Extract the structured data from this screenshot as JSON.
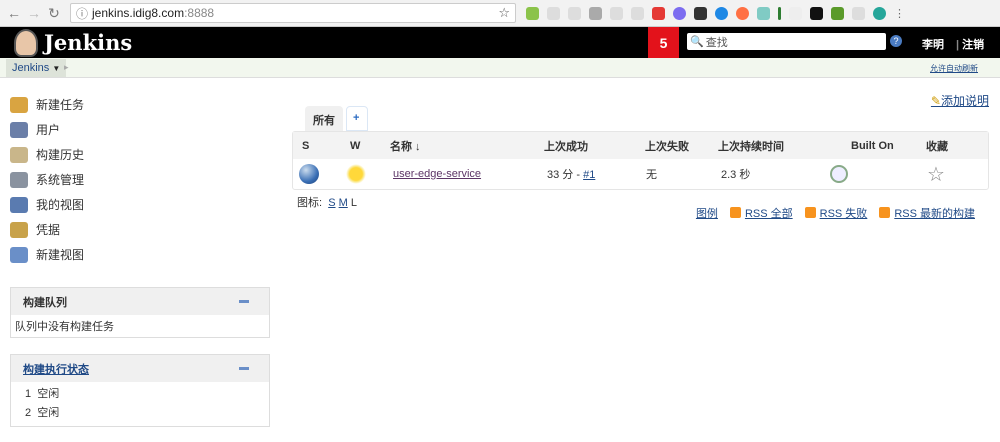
{
  "browser": {
    "url_host": "jenkins.idig8.com",
    "url_port": ":8888"
  },
  "header": {
    "title": "Jenkins",
    "notification_count": "5",
    "search_placeholder": "查找",
    "user": "李明",
    "logout": "注销"
  },
  "breadcrumb": {
    "root": "Jenkins",
    "auto_refresh": "允许自动刷新"
  },
  "sidebar": {
    "tasks": [
      {
        "label": "新建任务",
        "color": "#d9a441"
      },
      {
        "label": "用户",
        "color": "#6b7fa8"
      },
      {
        "label": "构建历史",
        "color": "#c9b68a"
      },
      {
        "label": "系统管理",
        "color": "#8a93a0"
      },
      {
        "label": "我的视图",
        "color": "#5a7bb0"
      },
      {
        "label": "凭据",
        "color": "#c8a24a"
      },
      {
        "label": "新建视图",
        "color": "#6a8fc8"
      }
    ],
    "build_queue": {
      "title": "构建队列",
      "empty": "队列中没有构建任务"
    },
    "executors": {
      "title": "构建执行状态",
      "items": [
        {
          "num": "1",
          "state": "空闲"
        },
        {
          "num": "2",
          "state": "空闲"
        }
      ]
    }
  },
  "main": {
    "add_description": "添加说明",
    "tabs": [
      "所有",
      "+"
    ],
    "columns": [
      "S",
      "W",
      "名称 ↓",
      "上次成功",
      "上次失败",
      "上次持续时间",
      "Built On",
      "收藏"
    ],
    "jobs": [
      {
        "name": "user-edge-service",
        "last_success": "33 分 - ",
        "last_success_build": "#1",
        "last_failure": "无",
        "last_duration": "2.3 秒"
      }
    ],
    "icon_size": {
      "label": "图标:",
      "options": [
        "S",
        "M",
        "L"
      ]
    },
    "footer_links": [
      "图例",
      "RSS 全部",
      "RSS 失败",
      "RSS 最新的构建"
    ]
  }
}
